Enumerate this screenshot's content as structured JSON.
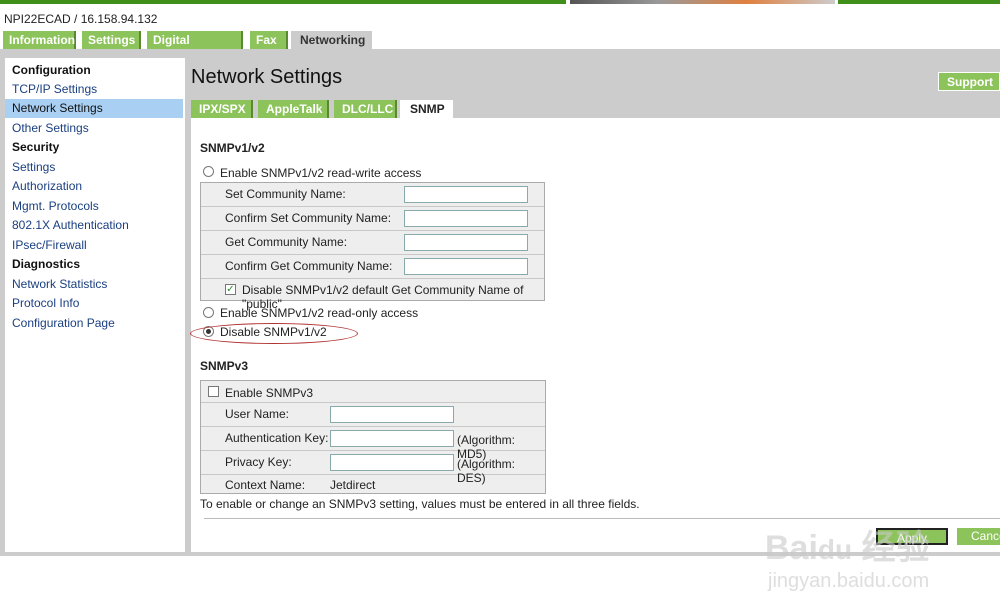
{
  "header": {
    "device": "NPI22ECAD / 16.158.94.132"
  },
  "tabs": [
    {
      "label": "Information"
    },
    {
      "label": "Settings"
    },
    {
      "label": "Digital Sending"
    },
    {
      "label": "Fax"
    },
    {
      "label": "Networking",
      "active": true
    }
  ],
  "sidebar": {
    "items": [
      {
        "label": "Configuration",
        "type": "heading"
      },
      {
        "label": "TCP/IP Settings"
      },
      {
        "label": "Network Settings",
        "selected": true
      },
      {
        "label": "Other Settings"
      },
      {
        "label": "Security",
        "type": "heading"
      },
      {
        "label": "Settings"
      },
      {
        "label": "Authorization"
      },
      {
        "label": "Mgmt. Protocols"
      },
      {
        "label": "802.1X Authentication"
      },
      {
        "label": "IPsec/Firewall"
      },
      {
        "label": "Diagnostics",
        "type": "heading"
      },
      {
        "label": "Network Statistics"
      },
      {
        "label": "Protocol Info"
      },
      {
        "label": "Configuration Page"
      }
    ]
  },
  "main": {
    "title": "Network Settings",
    "support_label": "Support",
    "subtabs": [
      {
        "label": "IPX/SPX"
      },
      {
        "label": "AppleTalk"
      },
      {
        "label": "DLC/LLC"
      },
      {
        "label": "SNMP",
        "active": true
      }
    ],
    "v12": {
      "heading": "SNMPv1/v2",
      "rw_label": "Enable SNMPv1/v2 read-write access",
      "fields": [
        {
          "label": "Set Community Name:",
          "value": ""
        },
        {
          "label": "Confirm Set Community Name:",
          "value": ""
        },
        {
          "label": "Get Community Name:",
          "value": ""
        },
        {
          "label": "Confirm Get Community Name:",
          "value": ""
        }
      ],
      "public_label": "Disable SNMPv1/v2 default Get Community Name of \"public\"",
      "public_checked": true,
      "ro_label": "Enable SNMPv1/v2 read-only access",
      "disable_label": "Disable SNMPv1/v2",
      "selected": "Disable SNMPv1/v2"
    },
    "v3": {
      "heading": "SNMPv3",
      "enable_label": "Enable SNMPv3",
      "enable_checked": false,
      "user_label": "User Name:",
      "auth_label": "Authentication Key:",
      "auth_algo": "(Algorithm: MD5)",
      "priv_label": "Privacy Key:",
      "priv_algo": "(Algorithm: DES)",
      "context_label": "Context Name:",
      "context_value": "Jetdirect",
      "note": "To enable or change an SNMPv3 setting, values must be entered in all three fields."
    },
    "apply_label": "Apply",
    "cancel_label": "Cancel"
  },
  "watermark": {
    "logo": "Bai du 经验",
    "url": "jingyan.baidu.com"
  },
  "colors": {
    "accent_green": "#8cc35a",
    "top_bar": "#3f8f1a",
    "selected": "#a9cff2",
    "annotation": "#b03030"
  }
}
